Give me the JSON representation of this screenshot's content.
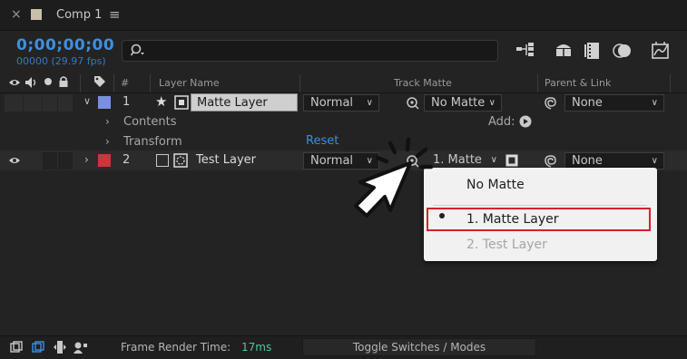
{
  "tab": {
    "close_glyph": "×",
    "title": "Comp 1",
    "menu_glyph": "≡"
  },
  "toolbar": {
    "timecode": "0;00;00;00",
    "fps": "00000 (29.97 fps)",
    "search_placeholder": "",
    "icons": [
      "composition-flowchart-icon",
      "draft-3d-icon",
      "frame-blending-icon",
      "motion-blur-icon",
      "graph-editor-icon"
    ]
  },
  "columns": {
    "layer_name": "Layer Name",
    "number": "#",
    "track_matte": "Track Matte",
    "parent_link": "Parent & Link"
  },
  "layers": [
    {
      "num": "1",
      "name": "Matte Layer",
      "label_color": "#7b8ee0",
      "mode": "Normal",
      "matte": "No Matte",
      "parent": "None"
    },
    {
      "num": "2",
      "name": "Test Layer",
      "label_color": "#c8383a",
      "mode": "Normal",
      "matte": "1. Matte",
      "parent": "None"
    }
  ],
  "properties": {
    "contents": "Contents",
    "add_label": "Add:",
    "transform": "Transform",
    "reset": "Reset"
  },
  "matte_menu": {
    "options": [
      "No Matte",
      "1. Matte Layer",
      "2. Test Layer"
    ],
    "selected": "1. Matte Layer",
    "disabled": "2. Test Layer",
    "highlight_color": "#d8202a"
  },
  "bottom": {
    "frame_render_label": "Frame Render Time:",
    "frame_render_value": "17ms",
    "toggle_label": "Toggle Switches / Modes"
  },
  "colors": {
    "accent_blue": "#3f8fe0",
    "render_time": "#56c1a5"
  }
}
